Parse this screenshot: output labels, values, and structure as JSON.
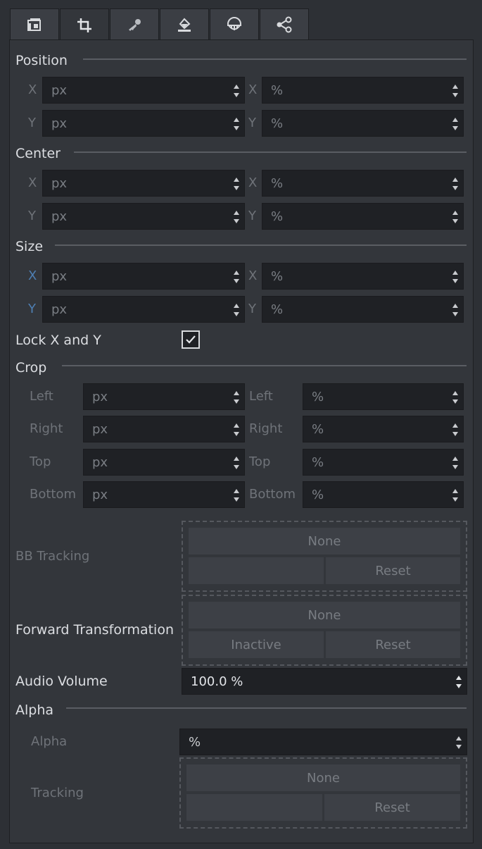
{
  "tabs": [
    {
      "name": "media-tab",
      "icon": "film-strip-icon"
    },
    {
      "name": "transform-tab",
      "icon": "crop-icon",
      "active": true
    },
    {
      "name": "key-tab",
      "icon": "key-icon"
    },
    {
      "name": "fill-tab",
      "icon": "paint-bucket-icon"
    },
    {
      "name": "mask-tab",
      "icon": "mask-icon"
    },
    {
      "name": "share-tab",
      "icon": "node-graph-icon"
    }
  ],
  "position": {
    "heading": "Position",
    "x_label": "X",
    "y_label": "Y",
    "x_px": "px",
    "x_pct": "%",
    "y_px": "px",
    "y_pct": "%"
  },
  "center": {
    "heading": "Center",
    "x_label": "X",
    "y_label": "Y",
    "x_px": "px",
    "x_pct": "%",
    "y_px": "px",
    "y_pct": "%"
  },
  "size": {
    "heading": "Size",
    "x_label": "X",
    "y_label": "Y",
    "x_px": "px",
    "x_pct": "%",
    "y_px": "px",
    "y_pct": "%"
  },
  "lock": {
    "label": "Lock X and Y",
    "checked": true
  },
  "crop": {
    "heading": "Crop",
    "left": "Left",
    "right": "Right",
    "top": "Top",
    "bottom": "Bottom",
    "px": "px",
    "pct": "%"
  },
  "bb_tracking": {
    "label": "BB Tracking",
    "none": "None",
    "reset": "Reset"
  },
  "forward": {
    "label": "Forward Transformation",
    "none": "None",
    "inactive": "Inactive",
    "reset": "Reset"
  },
  "audio": {
    "label": "Audio Volume",
    "value": "100.0 %"
  },
  "alpha": {
    "heading": "Alpha",
    "alpha_label": "Alpha",
    "alpha_value": "%",
    "tracking_label": "Tracking",
    "none": "None",
    "reset": "Reset"
  },
  "colors": {
    "accent_blue": "#4e7fb3",
    "panel": "#33363b",
    "field": "#1f2125"
  }
}
